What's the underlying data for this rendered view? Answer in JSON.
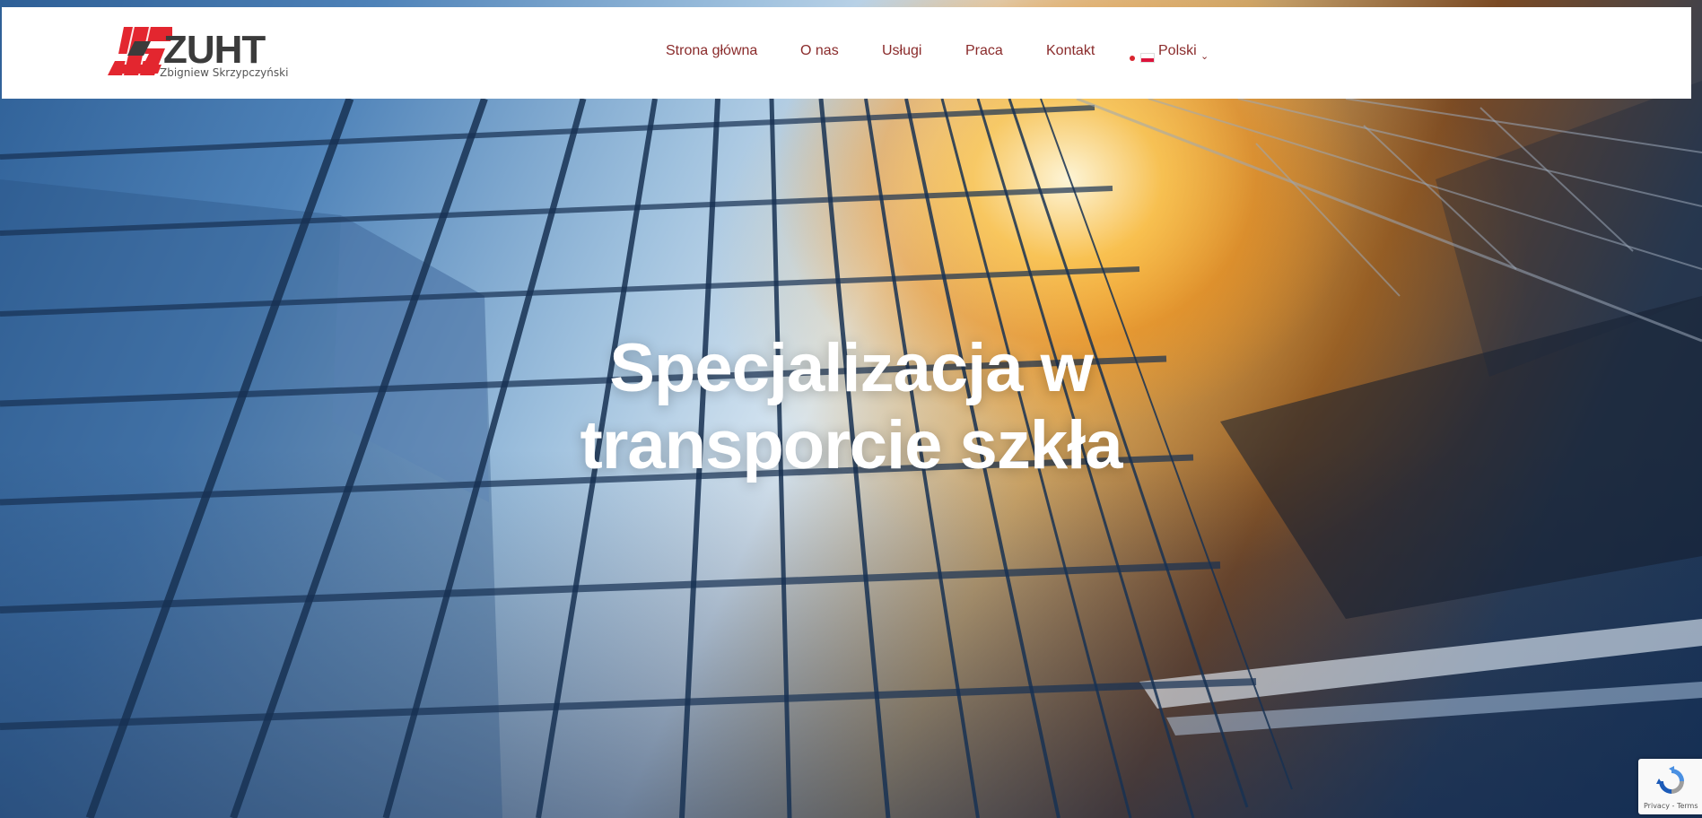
{
  "brand": {
    "logo_text": "ZUHT",
    "logo_subtitle": "Zbigniew Skrzypczyński",
    "colors": {
      "logo_red": "#e3262f",
      "logo_dark": "#3b3b3b",
      "nav_text": "#8a2b2b"
    }
  },
  "nav": {
    "items": [
      {
        "label": "Strona główna"
      },
      {
        "label": "O nas"
      },
      {
        "label": "Usługi"
      },
      {
        "label": "Praca"
      },
      {
        "label": "Kontakt"
      }
    ],
    "language": {
      "label": "Polski",
      "flag_icon": "poland-flag-icon",
      "chevron_icon": "chevron-down-icon"
    }
  },
  "hero": {
    "title_line1": "Specjalizacja w",
    "title_line2": "transporcie szkła"
  },
  "recaptcha": {
    "links": "Privacy - Terms",
    "icon": "recaptcha-icon"
  }
}
